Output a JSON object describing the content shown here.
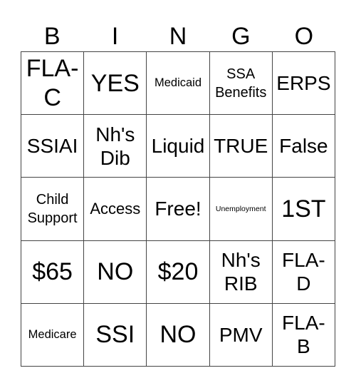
{
  "header": [
    "B",
    "I",
    "N",
    "G",
    "O"
  ],
  "cells": [
    [
      "FLA-\nC",
      "YES",
      "Medicaid",
      "SSA\nBenefits",
      "ERPS"
    ],
    [
      "SSIAI",
      "Nh's\nDib",
      "Liquid",
      "TRUE",
      "False"
    ],
    [
      "Child\nSupport",
      "Access",
      "Free!",
      "Unemployment",
      "1ST"
    ],
    [
      "$65",
      "NO",
      "$20",
      "Nh's\nRIB",
      "FLA-\nD"
    ],
    [
      "Medicare",
      "SSI",
      "NO",
      "PMV",
      "FLA-\nB"
    ]
  ],
  "colors": {
    "border": "#444444",
    "text": "#000000",
    "background": "#ffffff"
  }
}
